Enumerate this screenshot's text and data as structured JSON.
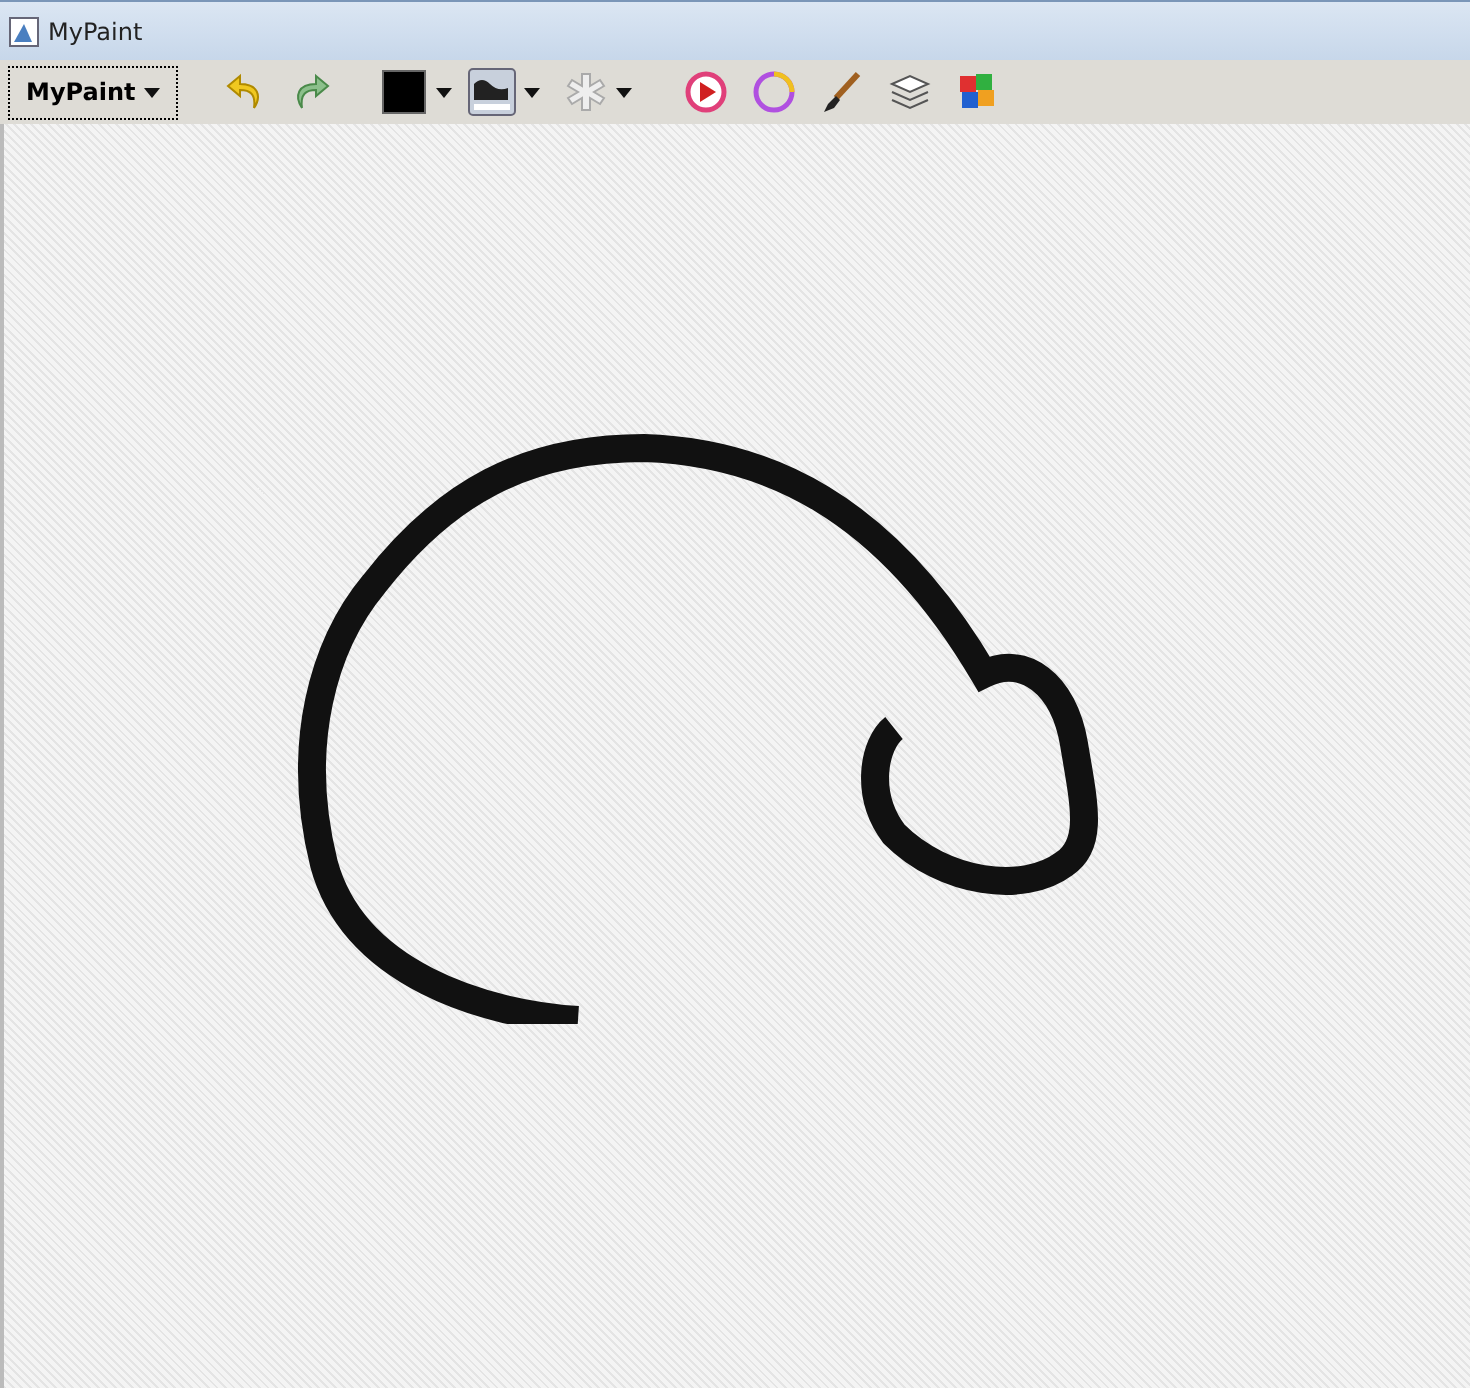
{
  "window": {
    "title": "MyPaint"
  },
  "toolbar": {
    "menu_label": "MyPaint",
    "color": "#000000"
  }
}
